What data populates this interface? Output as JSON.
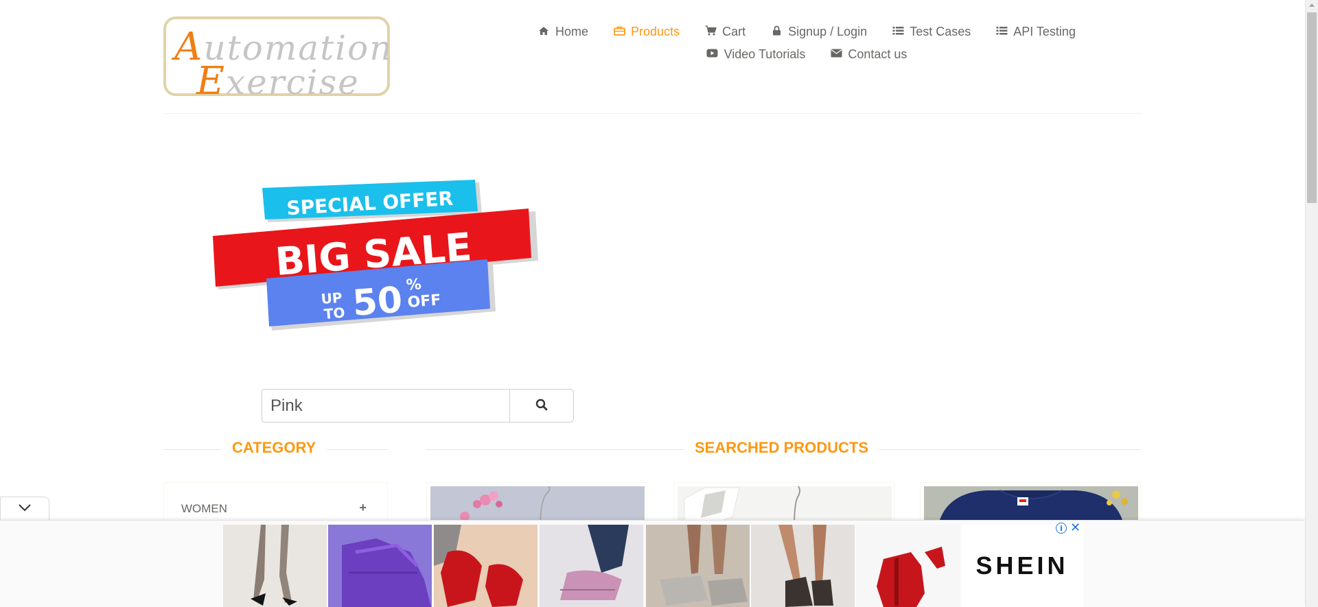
{
  "logo": {
    "line1_cap": "A",
    "line1_rest": "utomation",
    "line2_cap": "E",
    "line2_rest": "xercise"
  },
  "nav": {
    "items": [
      {
        "label": "Home",
        "icon": "home-icon"
      },
      {
        "label": "Products",
        "icon": "products-icon",
        "active": true
      },
      {
        "label": "Cart",
        "icon": "cart-icon"
      },
      {
        "label": "Signup / Login",
        "icon": "lock-icon"
      },
      {
        "label": "Test Cases",
        "icon": "list-icon"
      },
      {
        "label": "API Testing",
        "icon": "list-icon"
      },
      {
        "label": "Video Tutorials",
        "icon": "youtube-icon"
      },
      {
        "label": "Contact us",
        "icon": "envelope-icon"
      }
    ]
  },
  "banner": {
    "top_text": "SPECIAL OFFER",
    "middle_text": "BIG SALE",
    "up": "UP",
    "to": "TO",
    "percent": "50",
    "percent_sign": "%",
    "off": "OFF"
  },
  "search": {
    "value": "Pink",
    "icon": "search-icon"
  },
  "sections": {
    "category": "CATEGORY",
    "products": "SEARCHED PRODUCTS"
  },
  "category": {
    "items": [
      {
        "label": "WOMEN",
        "expand_symbol": "+"
      }
    ]
  },
  "ad": {
    "brand": "SHEIN",
    "info_symbol": "i",
    "close_symbol": "✕"
  },
  "colors": {
    "accent": "#fe980f",
    "text": "#696763",
    "ad_blue": "#1a73e8"
  }
}
